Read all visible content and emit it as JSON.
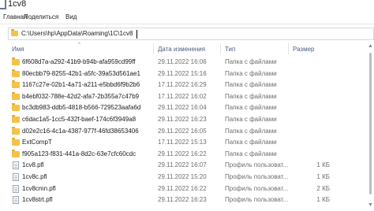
{
  "window": {
    "title": "1cv8"
  },
  "ribbon": {
    "tabs": [
      "Главная",
      "Поделиться",
      "Вид"
    ]
  },
  "address": {
    "path": "C:\\Users\\hp\\AppData\\Roaming\\1C\\1cv8"
  },
  "columns": {
    "name": "Имя",
    "date": "Дата изменения",
    "type": "Тип",
    "size": "Размер"
  },
  "icons": {
    "folder": "folder-icon",
    "file": "file-icon"
  },
  "colors": {
    "folder": "#f3c24b",
    "header_text": "#4d6082"
  },
  "files": [
    {
      "icon": "folder",
      "name": "6f608d7a-a292-41b9-b94b-afa959cd99ff",
      "date": "29.11.2022 16:06",
      "type": "Папка с файлами",
      "size": ""
    },
    {
      "icon": "folder",
      "name": "80ecbb79-8255-42b1-a5fc-39a53d561ae1",
      "date": "29.11.2022 15:16",
      "type": "Папка с файлами",
      "size": ""
    },
    {
      "icon": "folder",
      "name": "1167c27e-02b1-4a71-a211-e5bbd6f9b2b6",
      "date": "17.11.2022 16:29",
      "type": "Папка с файлами",
      "size": ""
    },
    {
      "icon": "folder",
      "name": "b4ebf032-788e-42d2-afa7-2b355a7c47b9",
      "date": "17.11.2022 16:02",
      "type": "Папка с файлами",
      "size": ""
    },
    {
      "icon": "folder",
      "name": "bc3db983-ddb5-4818-b566-729523aafa6d",
      "date": "29.11.2022 16:04",
      "type": "Папка с файлами",
      "size": ""
    },
    {
      "icon": "folder",
      "name": "c6dac1a5-1cc5-432f-baef-174c6f3949a8",
      "date": "29.11.2022 16:23",
      "type": "Папка с файлами",
      "size": ""
    },
    {
      "icon": "folder",
      "name": "d02e2c16-4c1a-4387-977f-46fd38653406",
      "date": "29.11.2022 16:05",
      "type": "Папка с файлами",
      "size": ""
    },
    {
      "icon": "folder",
      "name": "ExtCompT",
      "date": "17.11.2022 15:13",
      "type": "Папка с файлами",
      "size": ""
    },
    {
      "icon": "folder",
      "name": "f905a123-f831-441a-8d2c-63e7cfc60cdc",
      "date": "29.11.2022 16:22",
      "type": "Папка с файлами",
      "size": ""
    },
    {
      "icon": "file",
      "name": "1cv8.pfl",
      "date": "29.11.2022 16:07",
      "type": "Профиль пользоват...",
      "size": "1 КБ"
    },
    {
      "icon": "file",
      "name": "1cv8c.pfl",
      "date": "29.11.2022 15:20",
      "type": "Профиль пользоват...",
      "size": "1 КБ"
    },
    {
      "icon": "file",
      "name": "1cv8cmn.pfl",
      "date": "29.11.2022 16:22",
      "type": "Профиль пользоват...",
      "size": "2 КБ"
    },
    {
      "icon": "file",
      "name": "1cv8strt.pfl",
      "date": "29.11.2022 16:23",
      "type": "Профиль пользоват...",
      "size": "1 КБ"
    }
  ]
}
